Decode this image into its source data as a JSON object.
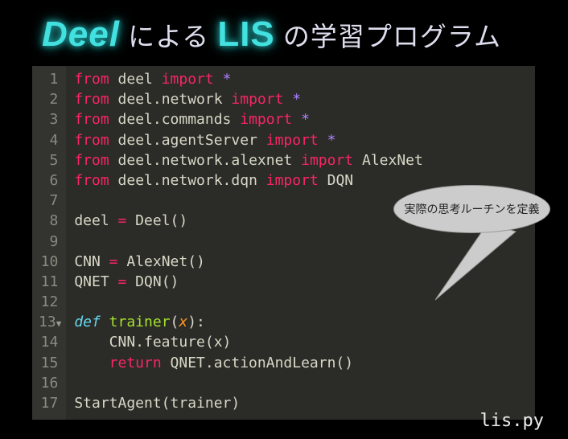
{
  "title": {
    "deel": "Deel",
    "mid1": " による ",
    "lis": "LIS",
    "mid2": " の学習プログラム"
  },
  "filename": "lis.py",
  "balloon": "実際の思考ルーチンを定義",
  "code": {
    "l1": {
      "kw": "from",
      "mod": "deel",
      "imp": "import",
      "star": "*"
    },
    "l2": {
      "kw": "from",
      "mod": "deel.network",
      "imp": "import",
      "star": "*"
    },
    "l3": {
      "kw": "from",
      "mod": "deel.commands",
      "imp": "import",
      "star": "*"
    },
    "l4": {
      "kw": "from",
      "mod": "deel.agentServer",
      "imp": "import",
      "star": "*"
    },
    "l5": {
      "kw": "from",
      "mod": "deel.network.alexnet",
      "imp": "import",
      "what": "AlexNet"
    },
    "l6": {
      "kw": "from",
      "mod": "deel.network.dqn",
      "imp": "import",
      "what": "DQN"
    },
    "l8_a": "deel ",
    "l8_eq": "=",
    "l8_b": " Deel()",
    "l10_a": "CNN ",
    "l10_eq": "=",
    "l10_b": " AlexNet()",
    "l11_a": "QNET ",
    "l11_eq": "=",
    "l11_b": " DQN()",
    "l13_def": "def",
    "l13_fn": "trainer",
    "l13_open": "(",
    "l13_arg": "x",
    "l13_close": "):",
    "l14": "    CNN.feature(x)",
    "l15_ret": "    return",
    "l15_b": " QNET.actionAndLearn()",
    "l17": "StartAgent(trainer)"
  },
  "lines": [
    "1",
    "2",
    "3",
    "4",
    "5",
    "6",
    "7",
    "8",
    "9",
    "10",
    "11",
    "12",
    "13",
    "14",
    "15",
    "16",
    "17"
  ]
}
